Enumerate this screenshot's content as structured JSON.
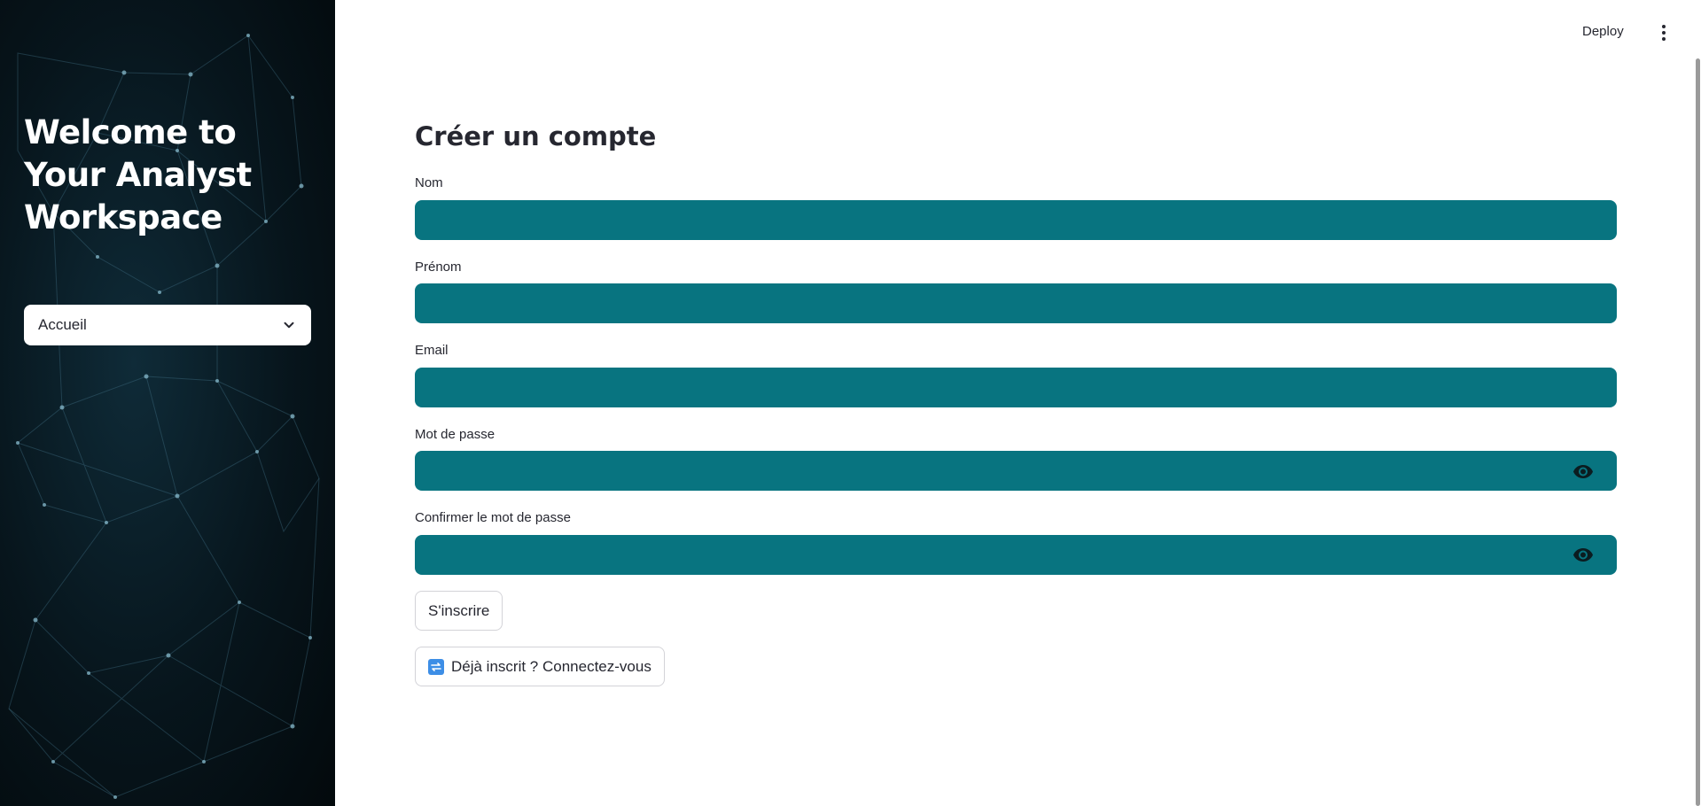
{
  "sidebar": {
    "title": "Welcome to Your Analyst Workspace",
    "nav_select": {
      "value": "Accueil"
    }
  },
  "header": {
    "deploy_label": "Deploy"
  },
  "form": {
    "title": "Créer un compte",
    "fields": [
      {
        "label": "Nom",
        "value": ""
      },
      {
        "label": "Prénom",
        "value": ""
      },
      {
        "label": "Email",
        "value": ""
      },
      {
        "label": "Mot de passe",
        "value": ""
      },
      {
        "label": "Confirmer le mot de passe",
        "value": ""
      }
    ],
    "submit_label": "S'inscrire",
    "login_link_label": "Déjà inscrit ? Connectez-vous"
  },
  "colors": {
    "input_background": "#087480",
    "sidebar_background": "#07151c",
    "text": "#262730"
  },
  "icons": {
    "nav_chevron": "chevron-down-icon",
    "menu": "kebab-menu-icon",
    "password_toggle": "eye-icon",
    "login_link": "swap-icon"
  }
}
